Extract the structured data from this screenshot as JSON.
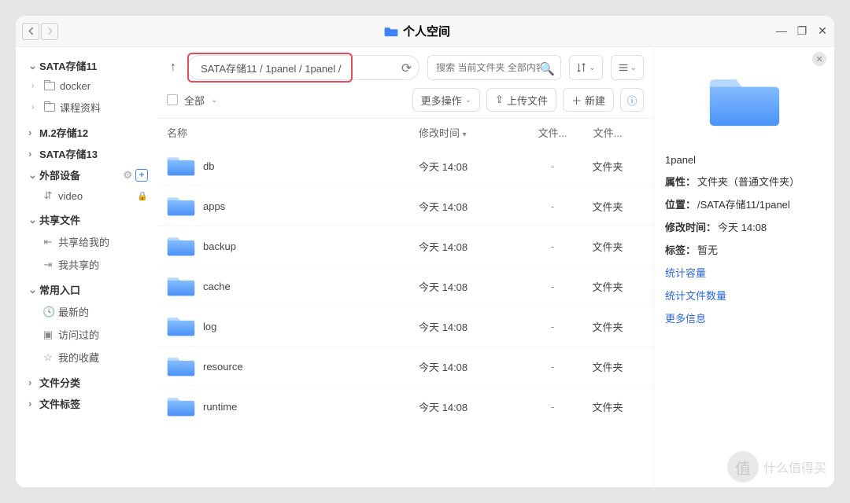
{
  "title": "个人空间",
  "path_value": "SATA存储11 / 1panel / 1panel /",
  "search_placeholder": "搜索 当前文件夹 全部内容",
  "second_row": {
    "all_label": "全部",
    "more_ops": "更多操作",
    "upload": "上传文件",
    "new_btn": "新建"
  },
  "columns": {
    "name": "名称",
    "mtime": "修改时间",
    "size": "文件...",
    "type": "文件..."
  },
  "rows": [
    {
      "name": "db",
      "mtime": "今天 14:08",
      "size": "-",
      "type": "文件夹"
    },
    {
      "name": "apps",
      "mtime": "今天 14:08",
      "size": "-",
      "type": "文件夹"
    },
    {
      "name": "backup",
      "mtime": "今天 14:08",
      "size": "-",
      "type": "文件夹"
    },
    {
      "name": "cache",
      "mtime": "今天 14:08",
      "size": "-",
      "type": "文件夹"
    },
    {
      "name": "log",
      "mtime": "今天 14:08",
      "size": "-",
      "type": "文件夹"
    },
    {
      "name": "resource",
      "mtime": "今天 14:08",
      "size": "-",
      "type": "文件夹"
    },
    {
      "name": "runtime",
      "mtime": "今天 14:08",
      "size": "-",
      "type": "文件夹"
    }
  ],
  "sidebar": {
    "sata11": {
      "label": "SATA存储11",
      "children": [
        "docker",
        "课程资料"
      ]
    },
    "m2": {
      "label": "M.2存储12"
    },
    "sata13": {
      "label": "SATA存储13"
    },
    "ext": {
      "label": "外部设备",
      "children": [
        {
          "name": "video"
        }
      ]
    },
    "share": {
      "label": "共享文件",
      "children": [
        "共享给我的",
        "我共享的"
      ]
    },
    "fav": {
      "label": "常用入口",
      "children": [
        "最新的",
        "访问过的",
        "我的收藏"
      ]
    },
    "class": {
      "label": "文件分类"
    },
    "tags": {
      "label": "文件标签"
    }
  },
  "details": {
    "name": "1panel",
    "attr_label": "属性：",
    "attr_value": "文件夹（普通文件夹）",
    "loc_label": "位置：",
    "loc_value": "/SATA存储11/1panel",
    "mt_label": "修改时间：",
    "mt_value": "今天 14:08",
    "tag_label": "标签：",
    "tag_value": "暂无",
    "link1": "统计容量",
    "link2": "统计文件数量",
    "link3": "更多信息"
  },
  "watermark": "什么值得买"
}
